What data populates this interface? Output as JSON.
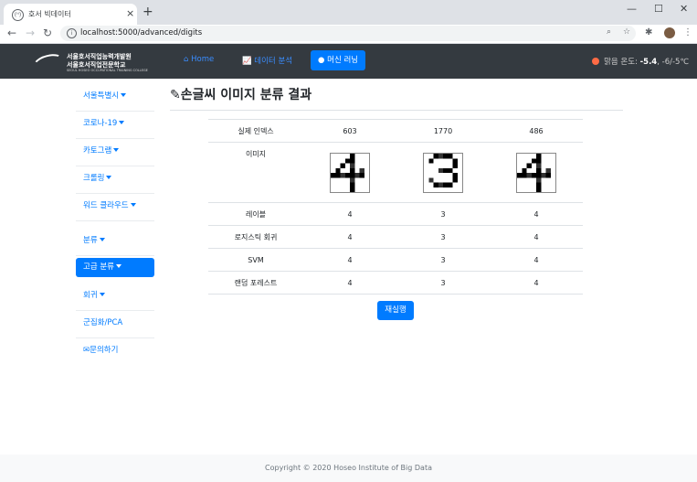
{
  "browser": {
    "tab_title": "호서 빅데이터",
    "favicon": "(ᴴ)",
    "url": "localhost:5000/advanced/digits",
    "win_controls": [
      "—",
      "☐",
      "✕"
    ]
  },
  "navbar": {
    "logo_line1": "서울호서직업능력개발원",
    "logo_line2": "서울호서직업전문학교",
    "logo_line3": "SEOUL HOSEO OCCUPATIONAL TRAINING COLLEGE",
    "links": [
      {
        "label": "Home",
        "icon": "home-icon"
      },
      {
        "label": "데이터 분석",
        "icon": "chart-icon"
      },
      {
        "label": "머신 러닝",
        "icon": "brain-icon"
      }
    ],
    "temperature": {
      "prefix": "맑음 온도:",
      "current": "-5.4",
      "range": ", -6/-5℃",
      "dot_color": "#ff6b45"
    }
  },
  "sidebar": {
    "items": [
      {
        "label": "서울특별시",
        "dropdown": true
      },
      {
        "label": "코로나-19",
        "dropdown": true
      },
      {
        "label": "카토그램",
        "dropdown": true
      },
      {
        "label": "크롤링",
        "dropdown": true
      },
      {
        "label": "워드 클라우드",
        "dropdown": true
      },
      {
        "label": "분류",
        "dropdown": true
      },
      {
        "label": "고급 분류",
        "dropdown": true,
        "active": true
      },
      {
        "label": "회귀",
        "dropdown": true
      },
      {
        "label": "군집화/PCA",
        "dropdown": false
      },
      {
        "label": "문의하기",
        "dropdown": false,
        "icon": "envelope-icon"
      }
    ]
  },
  "main": {
    "title": "손글씨 이미지 분류 결과",
    "title_icon": "pencil-icon",
    "rows": {
      "index_label": "실제 인덱스",
      "image_label": "이미지",
      "label_label": "레이블",
      "logreg_label": "로지스틱 회귀",
      "svm_label": "SVM",
      "rf_label": "랜덤 포레스트"
    },
    "columns": [
      {
        "index": "603",
        "digit": "4",
        "label": "4",
        "logreg": "4",
        "svm": "4",
        "rf": "4"
      },
      {
        "index": "1770",
        "digit": "3",
        "label": "3",
        "logreg": "3",
        "svm": "3",
        "rf": "3"
      },
      {
        "index": "486",
        "digit": "4",
        "label": "4",
        "logreg": "4",
        "svm": "4",
        "rf": "4"
      }
    ],
    "rerun_label": "재실행"
  },
  "footer": {
    "text": "Copyright © 2020 Hoseo Institute of Big Data"
  },
  "colors": {
    "accent": "#007bff",
    "navbar_bg": "#343a40",
    "footer_bg": "#f8f9fa"
  }
}
